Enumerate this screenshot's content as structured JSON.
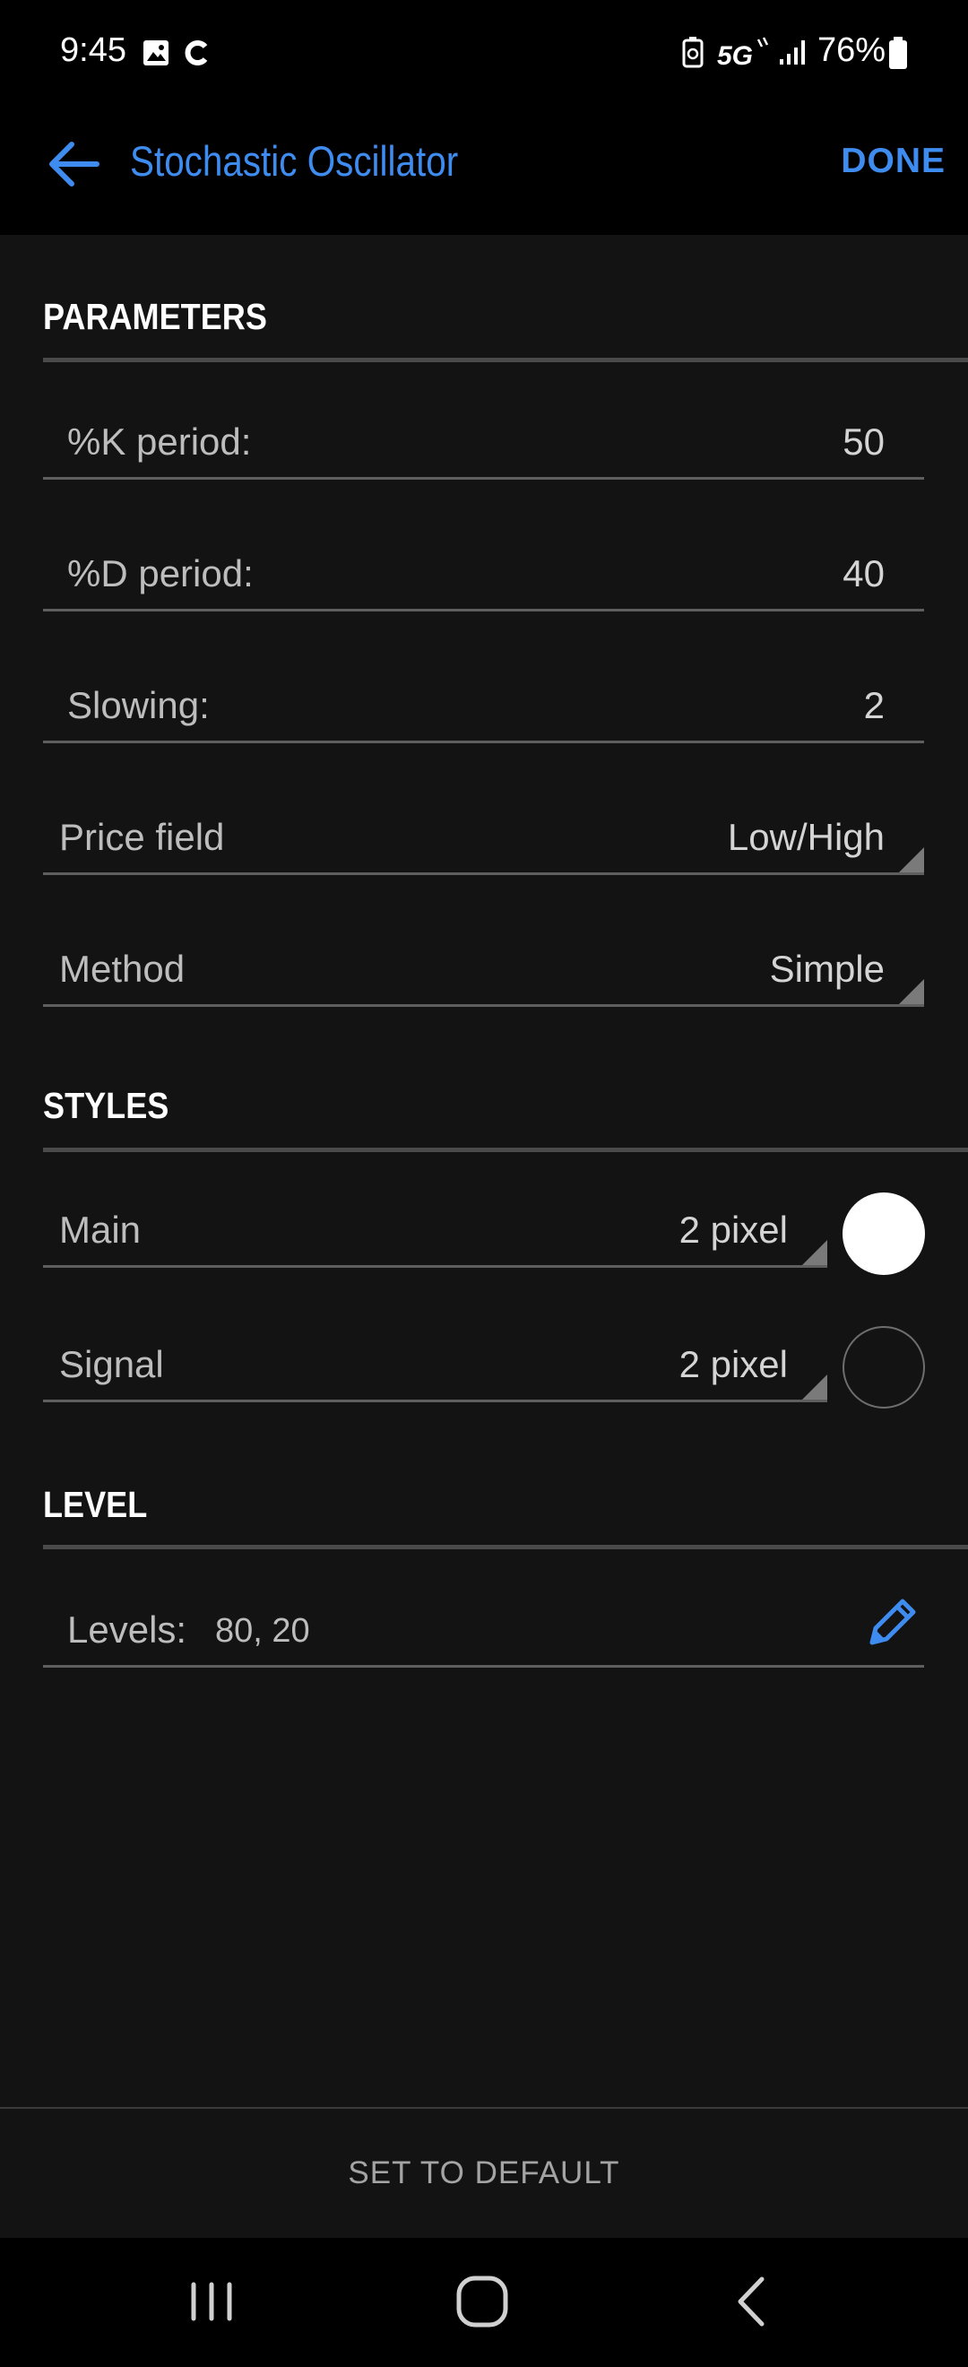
{
  "status_bar": {
    "time": "9:45",
    "battery": "76%",
    "icons": [
      "image-icon",
      "c-app-icon",
      "battery-saver-icon",
      "5g-icon",
      "signal-icon",
      "battery-icon"
    ]
  },
  "app_bar": {
    "title": "Stochastic Oscillator",
    "done_label": "DONE",
    "accent_color": "#3f8cf0"
  },
  "parameters": {
    "heading": "PARAMETERS",
    "k_period": {
      "label": "%K period:",
      "value": "50"
    },
    "d_period": {
      "label": "%D period:",
      "value": "40"
    },
    "slowing": {
      "label": "Slowing:",
      "value": "2"
    },
    "price_field": {
      "label": "Price field",
      "value": "Low/High"
    },
    "method": {
      "label": "Method",
      "value": "Simple"
    }
  },
  "styles": {
    "heading": "STYLES",
    "main": {
      "label": "Main",
      "value": "2 pixel",
      "color": "#ffffff"
    },
    "signal": {
      "label": "Signal",
      "value": "2 pixel",
      "color": "#131313"
    }
  },
  "level": {
    "heading": "LEVEL",
    "label": "Levels:",
    "value": "80, 20"
  },
  "footer": {
    "set_default_label": "SET TO DEFAULT"
  }
}
